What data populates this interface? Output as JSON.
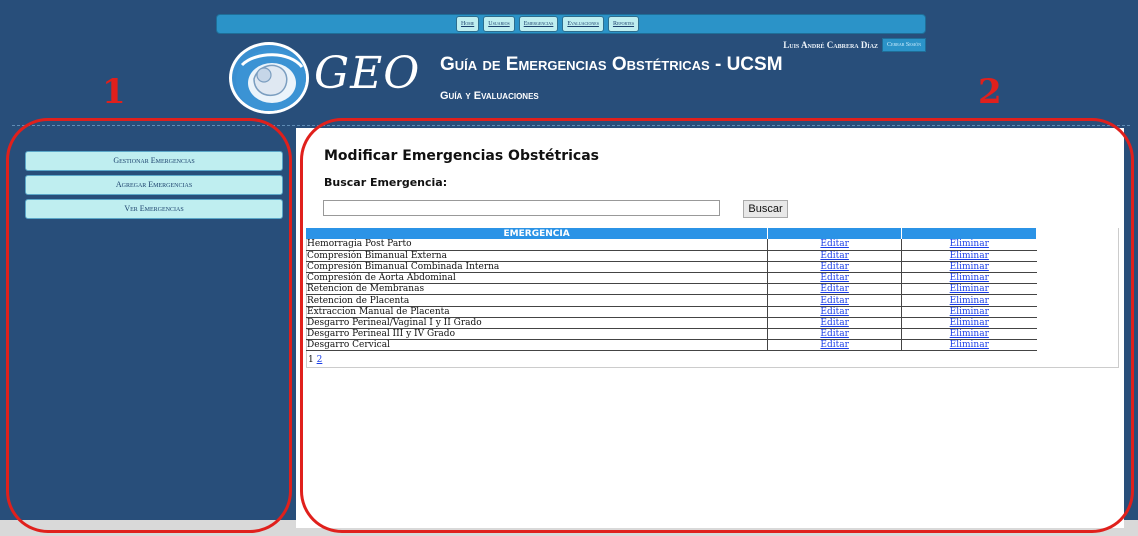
{
  "nav": {
    "items": [
      "Home",
      "Usuarios",
      "Emergencias",
      "Evaluaciones",
      "Reportes"
    ]
  },
  "user": {
    "name": "Luis André Cabrera Díaz",
    "logout_label": "Cerrar Sesión"
  },
  "branding": {
    "logo_text": "GEO",
    "title": "Guía de Emergencias Obstétricas - UCSM",
    "subtitle": "Guía y Evaluaciones"
  },
  "annotations": {
    "left_marker": "1",
    "right_marker": "2"
  },
  "sidebar": {
    "items": [
      "Gestionar Emergencias",
      "Agregar Emergencias",
      "Ver Emergencias"
    ]
  },
  "main": {
    "title": "Modificar Emergencias Obstétricas",
    "search_label": "Buscar Emergencia:",
    "search_value": "",
    "search_button": "Buscar",
    "table": {
      "headers": [
        "EMERGENCIA",
        "",
        ""
      ],
      "rows": [
        {
          "name": "Hemorragia Post Parto",
          "edit": "Editar",
          "delete": "Eliminar"
        },
        {
          "name": "Compresión Bimanual Externa",
          "edit": "Editar",
          "delete": "Eliminar"
        },
        {
          "name": "Compresión Bimanual Combinada Interna",
          "edit": "Editar",
          "delete": "Eliminar"
        },
        {
          "name": "Compresión de Aorta Abdominal",
          "edit": "Editar",
          "delete": "Eliminar"
        },
        {
          "name": "Retencion de Membranas",
          "edit": "Editar",
          "delete": "Eliminar"
        },
        {
          "name": "Retencion de Placenta",
          "edit": "Editar",
          "delete": "Eliminar"
        },
        {
          "name": "Extraccion Manual de Placenta",
          "edit": "Editar",
          "delete": "Eliminar"
        },
        {
          "name": "Desgarro Perineal/Vaginal I y II Grado",
          "edit": "Editar",
          "delete": "Eliminar"
        },
        {
          "name": "Desgarro Perineal III y IV Grado",
          "edit": "Editar",
          "delete": "Eliminar"
        },
        {
          "name": "Desgarro Cervical",
          "edit": "Editar",
          "delete": "Eliminar"
        }
      ]
    },
    "pager": {
      "current": "1",
      "next": "2"
    }
  },
  "colors": {
    "header_bg": "#284e7a",
    "accent_blue": "#2b93e6",
    "button_bg": "#bfeef0",
    "annotation_red": "#e0201c"
  }
}
